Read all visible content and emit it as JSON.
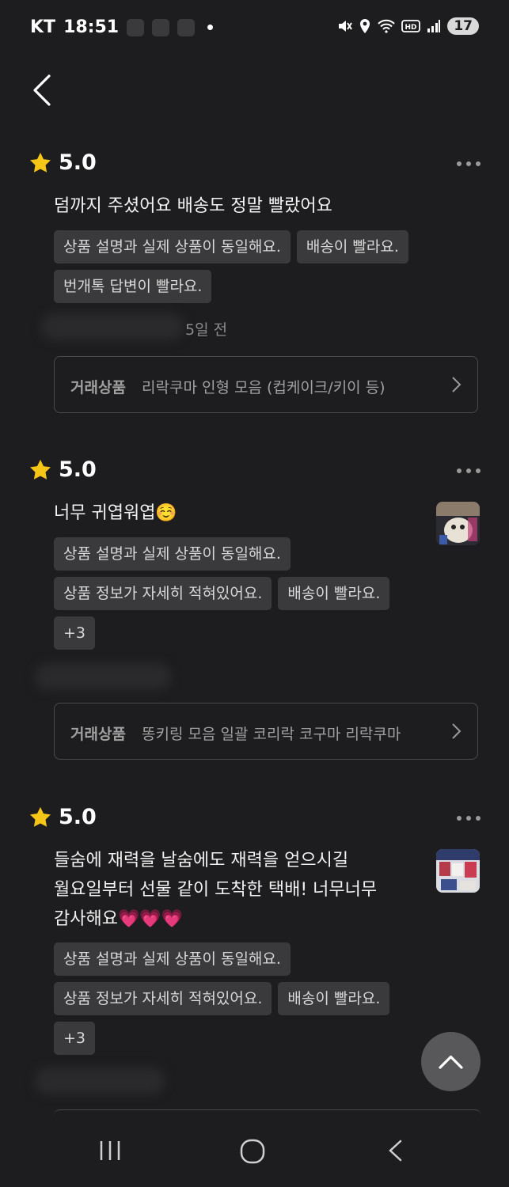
{
  "status": {
    "carrier": "KT",
    "time": "18:51",
    "notification_count": "17"
  },
  "reviews": [
    {
      "rating": "5.0",
      "text": "덤까지 주셨어요 배송도 정말 빨랐어요",
      "tags": [
        "상품 설명과 실제 상품이 동일해요.",
        "배송이 빨라요.",
        "번개톡 답변이 빨라요."
      ],
      "date": "5일 전",
      "product_label": "거래상품",
      "product_name": "리락쿠마 인형 모음 (컵케이크/키이 등)"
    },
    {
      "rating": "5.0",
      "text": "너무 귀엽워엽☺️",
      "tags": [
        "상품 설명과 실제 상품이 동일해요.",
        "상품 정보가 자세히 적혀있어요.",
        "배송이 빨라요.",
        "+3"
      ],
      "product_label": "거래상품",
      "product_name": "똥키링 모음 일괄 코리락 코구마 리락쿠마"
    },
    {
      "rating": "5.0",
      "text_lines": [
        "들숨에 재력을 날숨에도 재력을 얻으시길",
        "월요일부터 선물 같이 도착한 택배! 너무너무",
        "감사해요💗💗💗"
      ],
      "tags": [
        "상품 설명과 실제 상품이 동일해요.",
        "상품 정보가 자세히 적혀있어요.",
        "배송이 빨라요.",
        "+3"
      ]
    }
  ],
  "icons": {
    "back": "back-arrow-icon",
    "star": "star-icon",
    "more": "more-dots-icon",
    "chevron": "chevron-right-icon",
    "scroll_top": "chevron-up-icon"
  },
  "colors": {
    "background": "#1d1d1f",
    "chip": "#3a3a3d",
    "star": "#f5c518"
  }
}
